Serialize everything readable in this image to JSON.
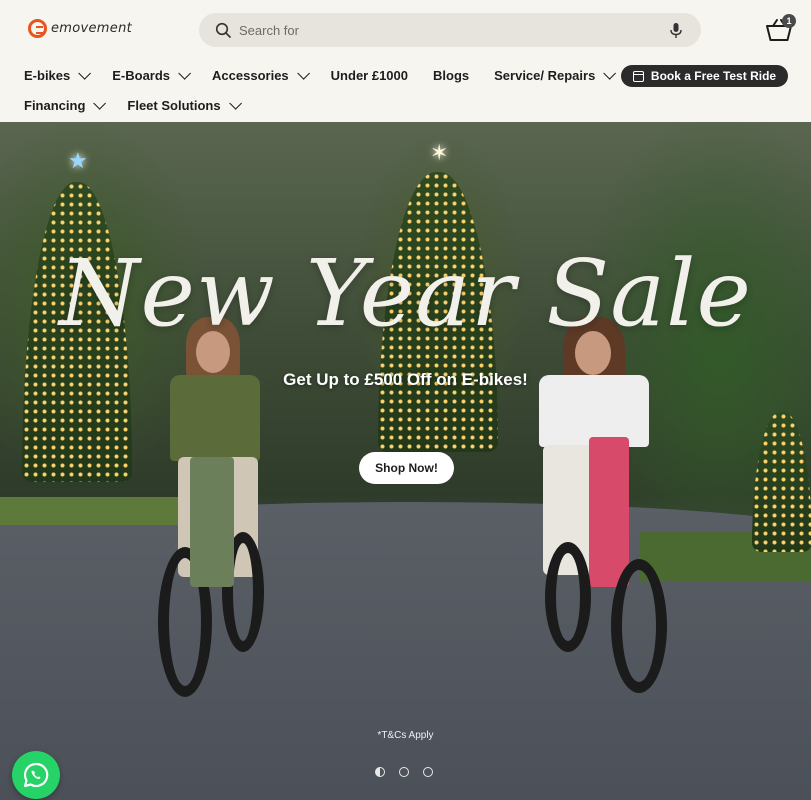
{
  "brand": {
    "name": "emovement",
    "accent": "#e8541e"
  },
  "search": {
    "placeholder": "Search for"
  },
  "cart": {
    "count": "1"
  },
  "nav": {
    "row1": [
      {
        "label": "E-bikes",
        "dropdown": true
      },
      {
        "label": "E-Boards",
        "dropdown": true
      },
      {
        "label": "Accessories",
        "dropdown": true
      },
      {
        "label": "Under £1000",
        "dropdown": false
      },
      {
        "label": "Blogs",
        "dropdown": false
      },
      {
        "label": "Service/ Repairs",
        "dropdown": true
      }
    ],
    "row2": [
      {
        "label": "Financing",
        "dropdown": true
      },
      {
        "label": "Fleet Solutions",
        "dropdown": true
      }
    ],
    "cta": "Book a Free Test Ride"
  },
  "hero": {
    "title": "New Year Sale",
    "subtitle": "Get Up to £500 Off on E-bikes!",
    "button": "Shop Now!",
    "terms": "*T&Cs Apply",
    "slides": 3,
    "active_slide": 1
  },
  "whatsapp": {
    "icon": "whatsapp-icon",
    "color": "#25d366"
  }
}
